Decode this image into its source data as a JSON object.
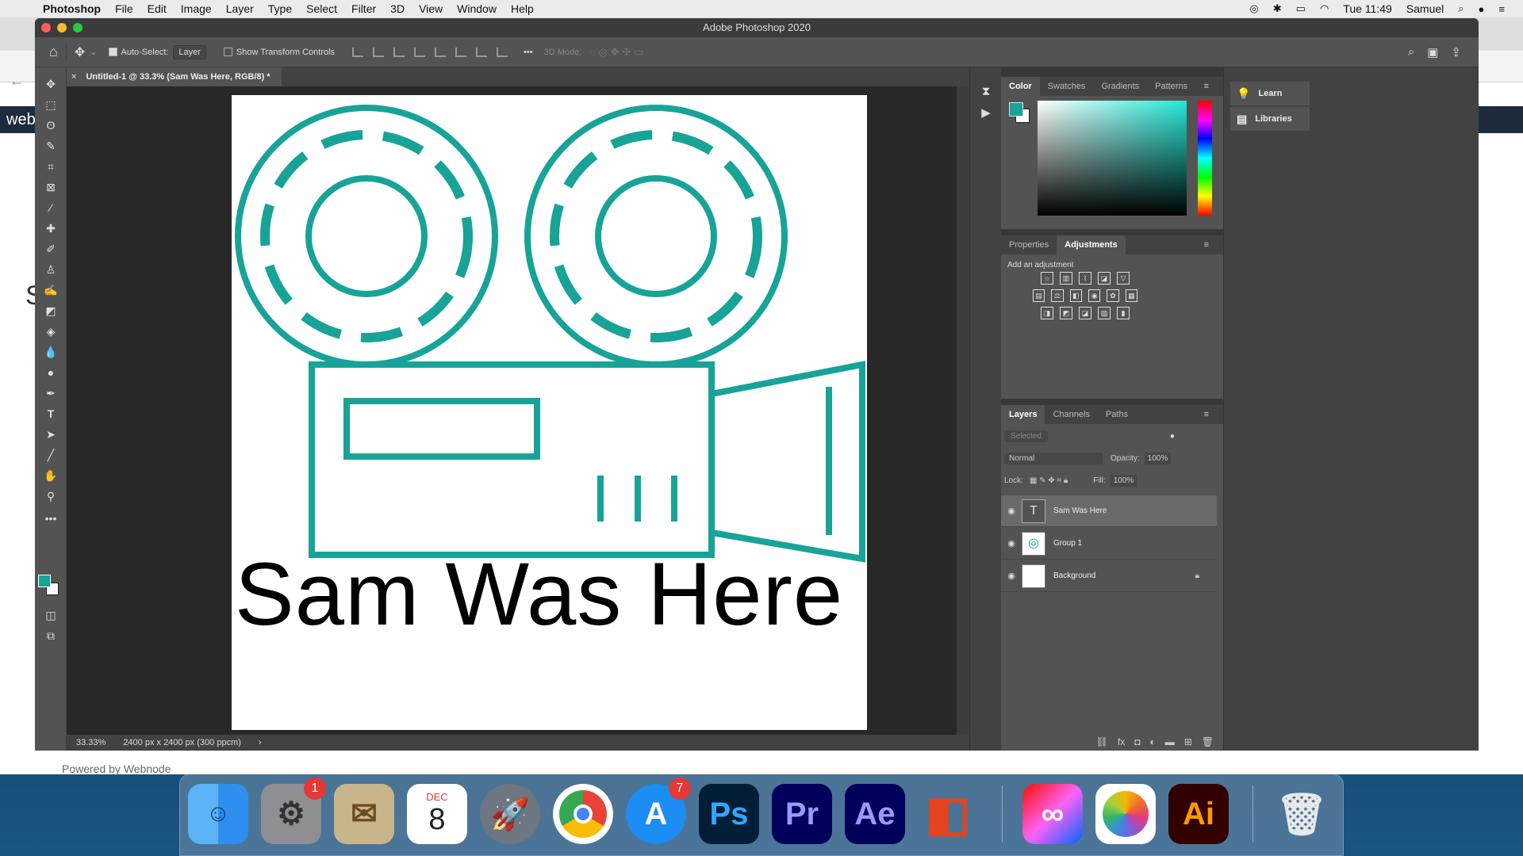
{
  "menubar": {
    "app": "Photoshop",
    "items": [
      "File",
      "Edit",
      "Image",
      "Layer",
      "Type",
      "Select",
      "Filter",
      "3D",
      "View",
      "Window",
      "Help"
    ],
    "clock": "Tue 11:49",
    "user": "Samuel"
  },
  "browser_behind": {
    "logo_text": "web",
    "big_letter": "S",
    "footer": "Powered by Webnode"
  },
  "window": {
    "title": "Adobe Photoshop 2020"
  },
  "options": {
    "auto_select_label": "Auto-Select:",
    "auto_select_value": "Layer",
    "show_transform": "Show Transform Controls",
    "mode_3d": "3D Mode:"
  },
  "document": {
    "tab_title": "Untitled-1 @ 33.3% (Sam Was Here, RGB/8) *",
    "canvas_text": "Sam Was Here"
  },
  "status": {
    "zoom": "33.33%",
    "size": "2400 px x 2400 px (300 ppcm)"
  },
  "color_panel": {
    "tabs": [
      "Color",
      "Swatches",
      "Gradients",
      "Patterns"
    ],
    "foreground": "#17a398"
  },
  "adjust_panel": {
    "tabs": [
      "Properties",
      "Adjustments"
    ],
    "hint": "Add an adjustment"
  },
  "layers_panel": {
    "tabs": [
      "Layers",
      "Channels",
      "Paths"
    ],
    "filter": "Selected",
    "blend_mode": "Normal",
    "opacity_label": "Opacity:",
    "opacity": "100%",
    "lock_label": "Lock:",
    "fill_label": "Fill:",
    "fill": "100%",
    "layers": [
      {
        "name": "Sam Was Here",
        "type": "text",
        "selected": true
      },
      {
        "name": "Group 1",
        "type": "group",
        "selected": false
      },
      {
        "name": "Background",
        "type": "background",
        "selected": false,
        "locked": true
      }
    ]
  },
  "learn_panel": {
    "learn": "Learn",
    "libraries": "Libraries"
  },
  "dock": {
    "badges": {
      "system_prefs": "1",
      "app_store": "7"
    },
    "calendar_month": "DEC",
    "calendar_day": "8",
    "apps": [
      "Finder",
      "System Preferences",
      "Mail",
      "Calendar",
      "Launchpad",
      "Chrome",
      "App Store",
      "Photoshop",
      "Premiere Pro",
      "After Effects",
      "Office",
      "Creative Cloud",
      "Photos",
      "Illustrator",
      "Trash"
    ],
    "labels": {
      "ps": "Ps",
      "pr": "Pr",
      "ae": "Ae",
      "ai": "Ai"
    }
  }
}
